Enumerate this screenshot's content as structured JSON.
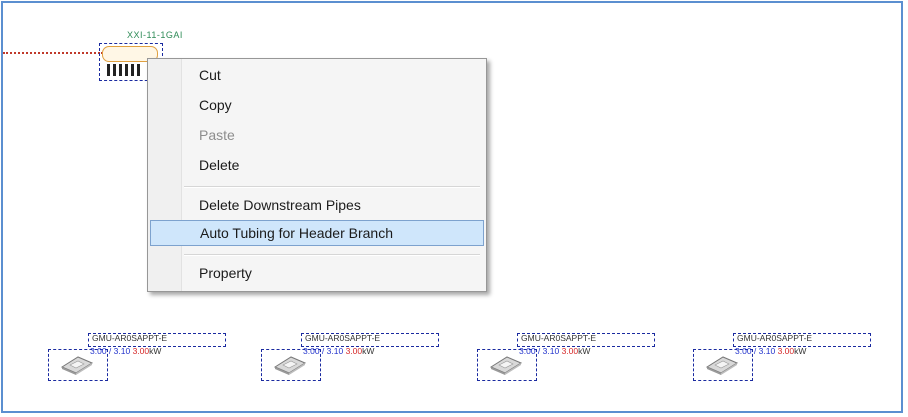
{
  "header_unit": {
    "label": "XXI-11-1GAI"
  },
  "context_menu": {
    "items": [
      {
        "label": "Cut",
        "enabled": true,
        "highlighted": false
      },
      {
        "label": "Copy",
        "enabled": true,
        "highlighted": false
      },
      {
        "label": "Paste",
        "enabled": false,
        "highlighted": false
      },
      {
        "label": "Delete",
        "enabled": true,
        "highlighted": false
      },
      {
        "label": "Delete Downstream Pipes",
        "enabled": true,
        "highlighted": false
      },
      {
        "label": "Auto Tubing for Header Branch",
        "enabled": true,
        "highlighted": true
      },
      {
        "label": "Property",
        "enabled": true,
        "highlighted": false
      }
    ]
  },
  "indoor_units": [
    {
      "model": "GMU-AR0SAPPT-E",
      "val1": "3.00",
      "sep": "/",
      "val2": "3.10",
      "val3": "3.00",
      "unit": "kW"
    },
    {
      "model": "GMU-AR0SAPPT-E",
      "val1": "3.00",
      "sep": "/",
      "val2": "3.10",
      "val3": "3.00",
      "unit": "kW"
    },
    {
      "model": "GMU-AR0SAPPT-E",
      "val1": "3.00",
      "sep": "/",
      "val2": "3.10",
      "val3": "3.00",
      "unit": "kW"
    },
    {
      "model": "GMU-AR0SAPPT-E",
      "val1": "3.00",
      "sep": "/",
      "val2": "3.10",
      "val3": "3.00",
      "unit": "kW"
    }
  ],
  "colors": {
    "frame": "#5b8fd0",
    "menu_highlight": "#cfe6fb",
    "selection": "#1a2aa0",
    "pipe": "#c0392b"
  }
}
